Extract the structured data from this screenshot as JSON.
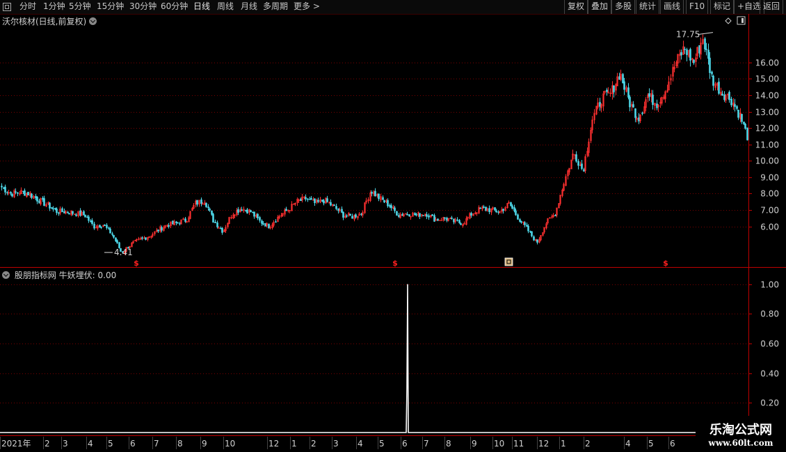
{
  "toolbar": {
    "periods": [
      {
        "label": "分时"
      },
      {
        "label": "1分钟"
      },
      {
        "label": "5分钟"
      },
      {
        "label": "15分钟"
      },
      {
        "label": "30分钟"
      },
      {
        "label": "60分钟"
      },
      {
        "label": "日线"
      },
      {
        "label": "周线"
      },
      {
        "label": "月线"
      },
      {
        "label": "多周期"
      },
      {
        "label": "更多 >"
      }
    ],
    "active_period": "日线",
    "actions": [
      {
        "label": "复权"
      },
      {
        "label": "叠加"
      },
      {
        "label": "多股"
      },
      {
        "label": "统计"
      },
      {
        "label": "画线"
      },
      {
        "label": "F10"
      },
      {
        "label": "标记"
      },
      {
        "label": "+自选"
      },
      {
        "label": "返回"
      }
    ]
  },
  "price_panel": {
    "title": "沃尔核材(日线,前复权)",
    "high_marker": "17.75",
    "low_marker": "4.41",
    "signal_marker": "$"
  },
  "indicator_panel": {
    "title": "股朋指标网 牛妖埋伏: 0.00"
  },
  "watermark": {
    "name": "乐淘公式网",
    "url": "www.60lt.com"
  },
  "colors": {
    "up": "#ff3030",
    "down": "#4ed8e8",
    "grid": "#7a0000",
    "axis": "#c00000",
    "indicator": "#ffffff"
  },
  "chart_data": [
    {
      "type": "candlestick",
      "title": "沃尔核材(日线,前复权)",
      "ylim": [
        4.2,
        18.2
      ],
      "y_ticks": [
        "6.00",
        "7.00",
        "8.00",
        "9.00",
        "10.00",
        "11.00",
        "12.00",
        "13.00",
        "14.00",
        "15.00",
        "16.00"
      ],
      "annotations": [
        {
          "label": "17.75",
          "type": "high"
        },
        {
          "label": "4.41",
          "type": "low"
        }
      ],
      "x_ticks": [
        "2021年",
        "2",
        "3",
        "4",
        "5",
        "6",
        "7",
        "8",
        "9",
        "10",
        "12",
        "1",
        "2",
        "3",
        "4",
        "5",
        "6",
        "7",
        "8",
        "9",
        "10",
        "11",
        "12",
        "1",
        "2",
        "4",
        "5",
        "6"
      ],
      "close_path": [
        8.4,
        8.0,
        8.1,
        8.0,
        7.6,
        7.3,
        6.9,
        6.9,
        6.8,
        6.7,
        6.0,
        6.1,
        5.5,
        4.4,
        4.9,
        5.2,
        5.4,
        5.8,
        6.1,
        6.2,
        6.4,
        7.4,
        7.6,
        6.3,
        5.7,
        6.8,
        7.1,
        6.9,
        6.3,
        6.0,
        6.6,
        7.0,
        7.5,
        7.7,
        7.4,
        7.6,
        7.2,
        6.7,
        6.6,
        6.8,
        8.2,
        7.7,
        7.3,
        6.7,
        6.8,
        6.7,
        6.8,
        6.4,
        6.5,
        6.3,
        6.2,
        6.8,
        7.1,
        7.0,
        6.9,
        7.4,
        6.5,
        5.8,
        5.0,
        6.2,
        6.8,
        8.8,
        10.5,
        9.4,
        12.5,
        13.8,
        14.1,
        15.4,
        13.6,
        12.6,
        14.0,
        13.5,
        14.4,
        15.9,
        16.9,
        16.0,
        17.5,
        15.0,
        14.2,
        13.8,
        12.8,
        11.2
      ]
    },
    {
      "type": "line",
      "title": "股朋指标网 牛妖埋伏: 0.00",
      "ylim": [
        0,
        1.05
      ],
      "y_ticks": [
        "0.20",
        "0.40",
        "0.60",
        "0.80",
        "1.00"
      ],
      "signal_value": 1,
      "current_value": 0
    }
  ]
}
